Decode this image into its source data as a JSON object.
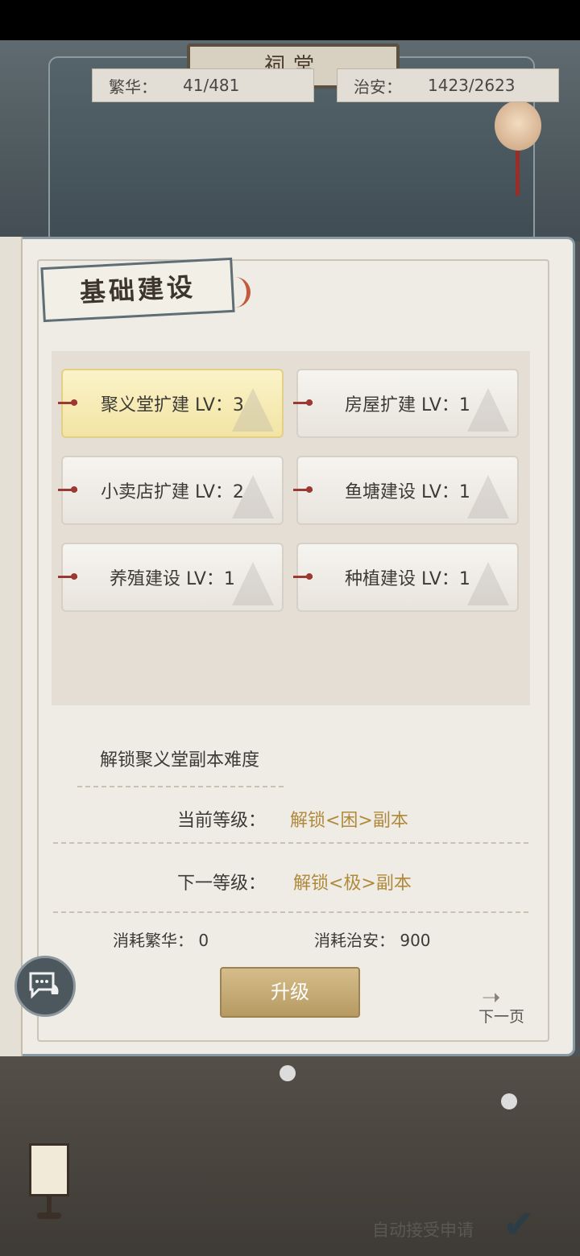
{
  "header": {
    "sign_text": "祠堂",
    "prosperity": {
      "label": "繁华：",
      "value": "41/481"
    },
    "security": {
      "label": "治安：",
      "value": "1423/2623"
    }
  },
  "panel": {
    "title": "基础建设",
    "buildings": [
      {
        "label": "聚义堂扩建 LV：3",
        "selected": true
      },
      {
        "label": "房屋扩建 LV：1",
        "selected": false
      },
      {
        "label": "小卖店扩建 LV：2",
        "selected": false
      },
      {
        "label": "鱼塘建设 LV：1",
        "selected": false
      },
      {
        "label": "养殖建设 LV：1",
        "selected": false
      },
      {
        "label": "种植建设 LV：1",
        "selected": false
      }
    ],
    "detail": {
      "title": "解锁聚义堂副本难度",
      "current_label": "当前等级：",
      "current_value": "解锁<困>副本",
      "next_label": "下一等级：",
      "next_value": "解锁<极>副本",
      "cost_prosperity": "消耗繁华：  0",
      "cost_security": "消耗治安：  900"
    },
    "upgrade_label": "升级",
    "next_page_label": "下一页"
  },
  "footer": {
    "auto_accept_label": "自动接受申请",
    "auto_accept_checked": true
  },
  "icons": {
    "chat": "chat-bubble-icon",
    "next": "arrow-right-icon",
    "check": "checkmark-icon"
  },
  "colors": {
    "gold_text": "#b08a3c",
    "selected_card": "#f2e4a4",
    "button": "#c9af77"
  }
}
